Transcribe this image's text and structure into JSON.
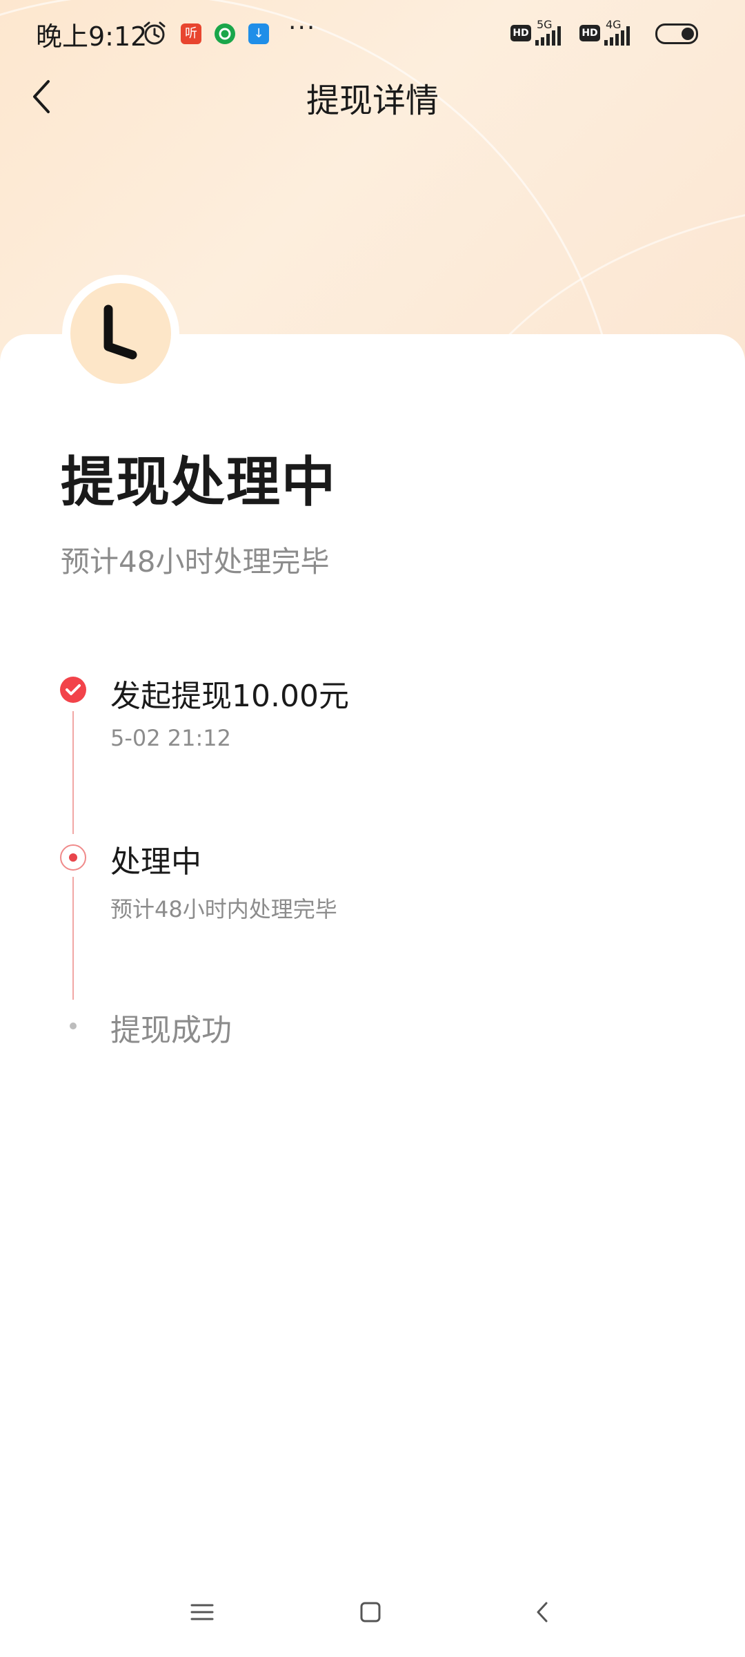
{
  "status_bar": {
    "time": "晚上9:12",
    "app_icon_1": "听",
    "app_icon_3": "↓",
    "more": "···",
    "hd_1": "HD",
    "network_1": "5G",
    "hd_2": "HD",
    "network_2": "4G"
  },
  "header": {
    "title": "提现详情"
  },
  "status": {
    "title": "提现处理中",
    "subtitle": "预计48小时处理完毕"
  },
  "timeline": [
    {
      "title": "发起提现10.00元",
      "time": "5-02 21:12",
      "state": "done"
    },
    {
      "title": "处理中",
      "time": "预计48小时内处理完毕",
      "state": "current"
    },
    {
      "title": "提现成功",
      "state": "pending"
    }
  ],
  "colors": {
    "accent_red": "#f2434a",
    "hero_gradient": "#fde7cf",
    "text_primary": "#1a1a1a",
    "text_secondary": "#8c8c8c"
  }
}
